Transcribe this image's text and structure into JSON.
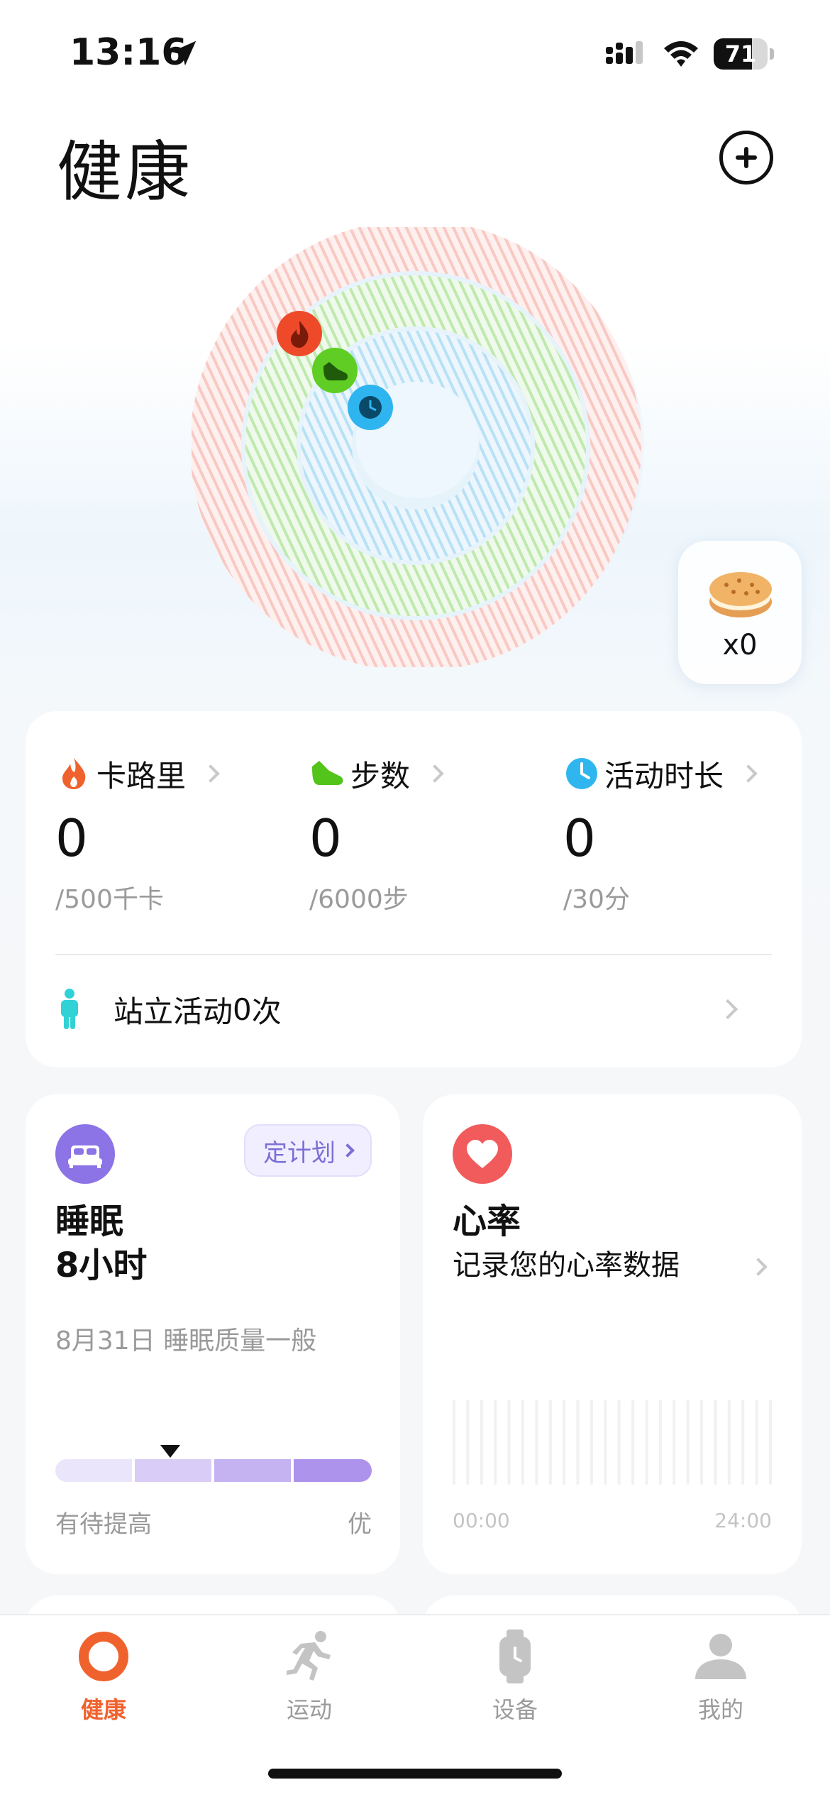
{
  "status_bar": {
    "time": "13:16",
    "battery": "71",
    "battery_level": 0.71
  },
  "header": {
    "title": "健康"
  },
  "reward": {
    "count": "x0"
  },
  "activity": {
    "metrics": [
      {
        "label": "卡路里",
        "value": "0",
        "target": "/500千卡",
        "color": "#f0622d",
        "icon": "flame-icon"
      },
      {
        "label": "步数",
        "value": "0",
        "target": "/6000步",
        "color": "#52c41a",
        "icon": "shoe-icon"
      },
      {
        "label": "活动时长",
        "value": "0",
        "target": "/30分",
        "color": "#2fb6ef",
        "icon": "clock-icon"
      }
    ],
    "stand": {
      "label": "站立活动 ",
      "value": "0",
      "unit": "次"
    }
  },
  "sleep": {
    "title": "睡眠",
    "hours": "8小时",
    "plan_label": "定计划",
    "date_quality": "8月31日 睡眠质量一般",
    "quality_low": "有待提高",
    "quality_high": "优"
  },
  "heart": {
    "title": "心率",
    "subtitle": "记录您的心率数据",
    "time_start": "00:00",
    "time_end": "24:00"
  },
  "tabs": [
    {
      "label": "健康",
      "icon": "health-ring-icon",
      "active": true
    },
    {
      "label": "运动",
      "icon": "running-icon",
      "active": false
    },
    {
      "label": "设备",
      "icon": "watch-icon",
      "active": false
    },
    {
      "label": "我的",
      "icon": "profile-icon",
      "active": false
    }
  ],
  "colors": {
    "accent": "#f0622d",
    "calorie": "#f0622d",
    "steps": "#52c41a",
    "activity": "#2fb6ef",
    "sleep": "#8c73e6",
    "heart": "#f25b5b",
    "stand": "#30d2d6"
  }
}
